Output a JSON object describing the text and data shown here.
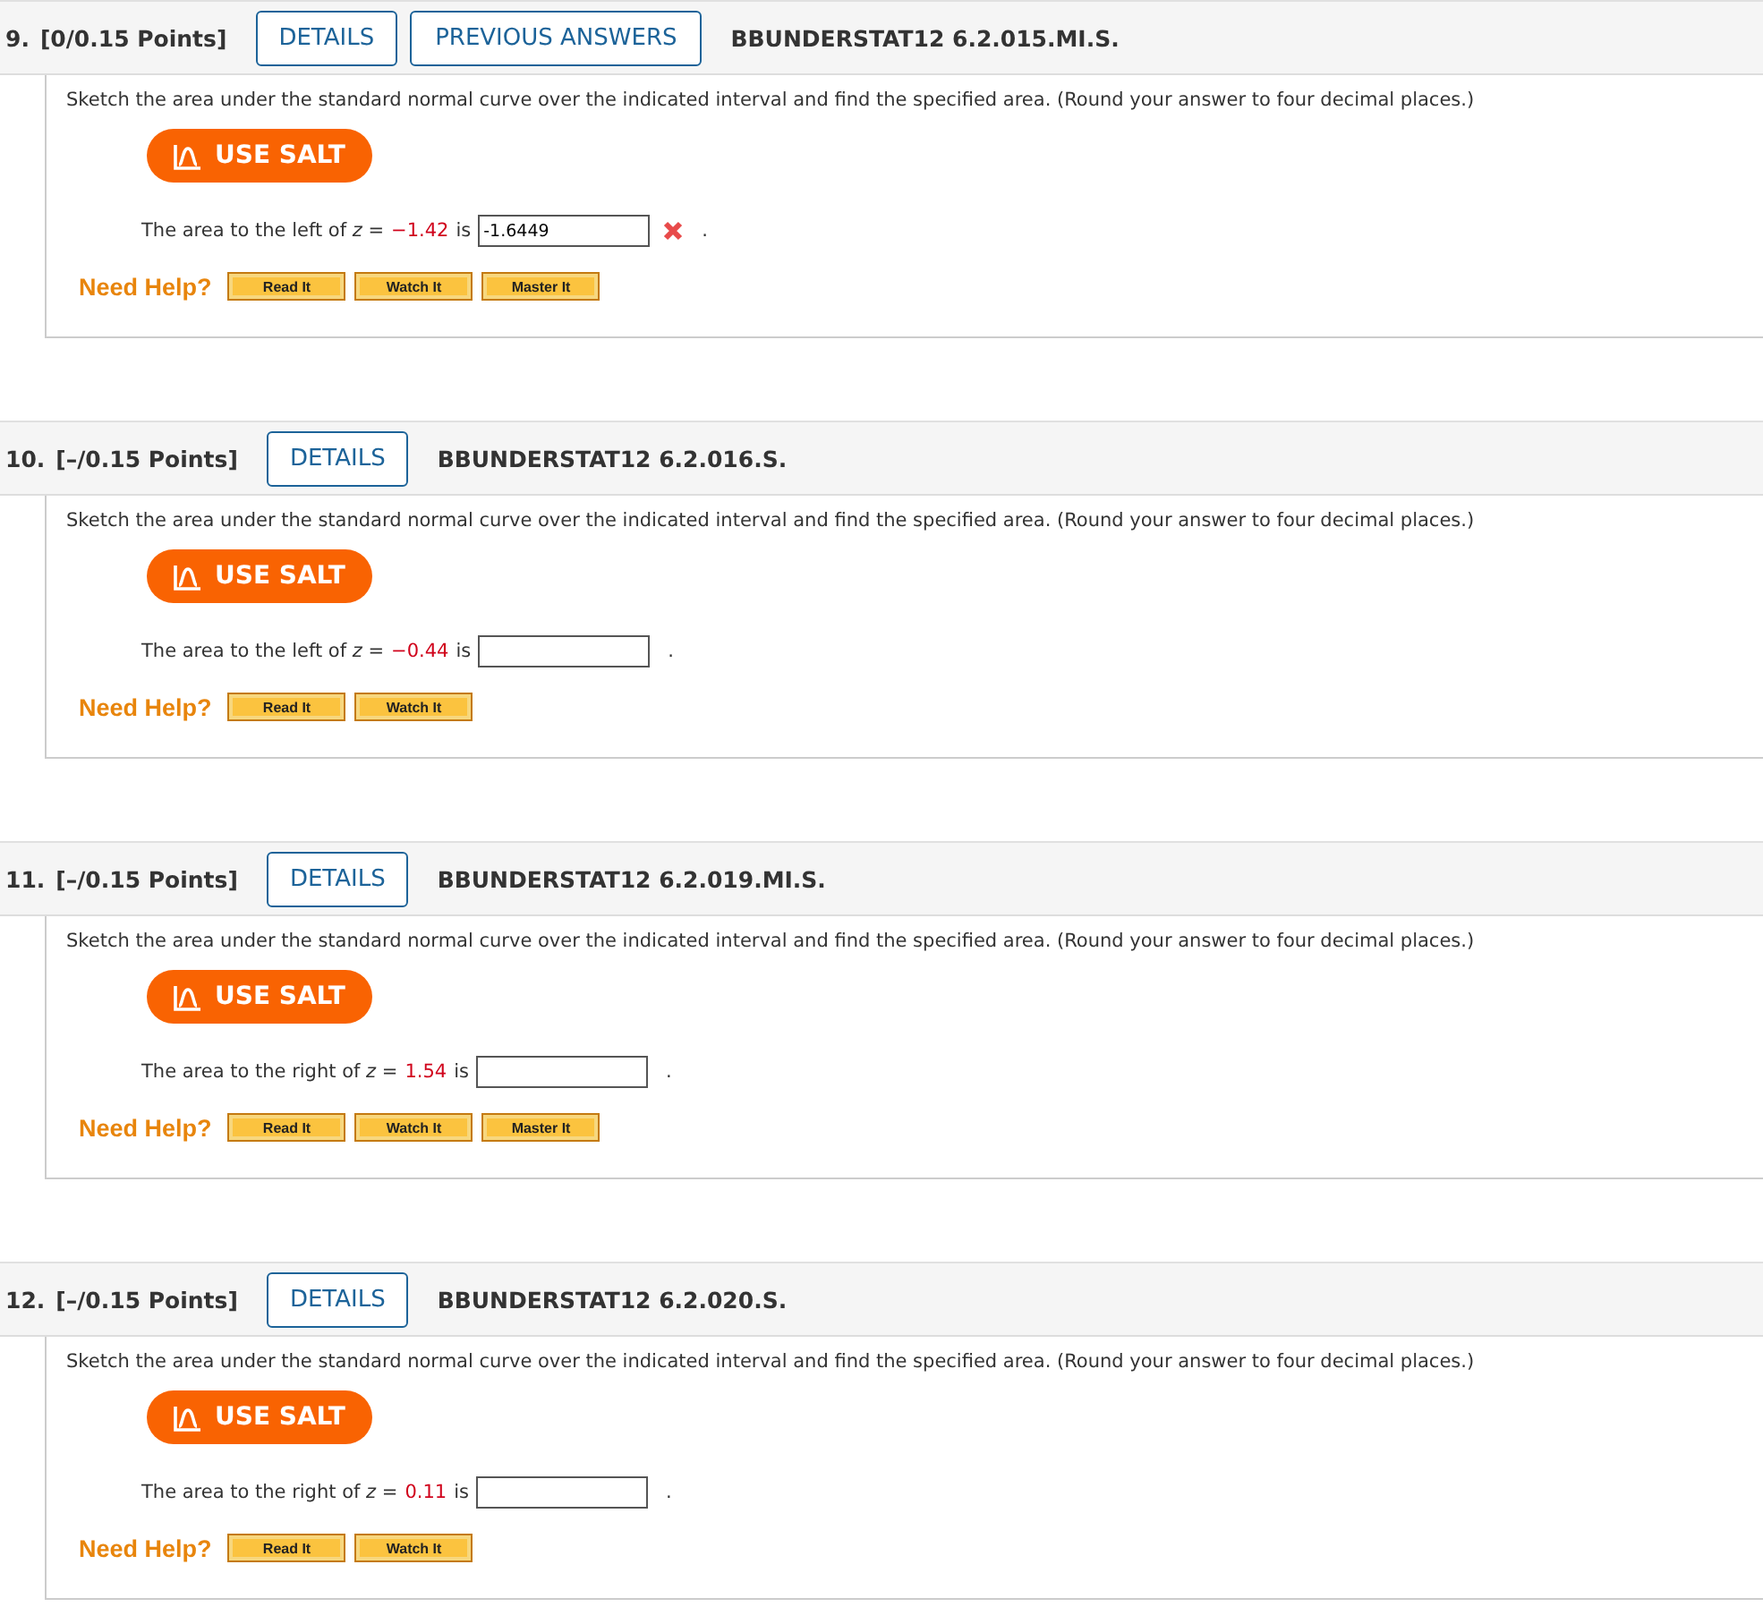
{
  "questions": [
    {
      "number": "9.",
      "points": "[0/0.15 Points]",
      "buttons": [
        {
          "kind": "details",
          "label": "DETAILS"
        },
        {
          "kind": "previous",
          "label": "PREVIOUS ANSWERS"
        }
      ],
      "code": "BBUNDERSTAT12 6.2.015.MI.S.",
      "instruction": "Sketch the area under the standard normal curve over the indicated interval and find the specified area. (Round your answer to four decimal places.)",
      "salt_label": "USE SALT",
      "prompt": "The area to the left of *z* =",
      "z_value": "−1.42",
      "prompt_end": "is",
      "answer": "-1.6449",
      "incorrect": true,
      "period": ".",
      "help_label": "Need Help?",
      "help_buttons": [
        "Read It",
        "Watch It",
        "Master It"
      ]
    },
    {
      "number": "10.",
      "points": "[–/0.15 Points]",
      "buttons": [
        {
          "kind": "details",
          "label": "DETAILS"
        }
      ],
      "code": "BBUNDERSTAT12 6.2.016.S.",
      "instruction": "Sketch the area under the standard normal curve over the indicated interval and find the specified area. (Round your answer to four decimal places.)",
      "salt_label": "USE SALT",
      "prompt": "The area to the left of *z* =",
      "z_value": "−0.44",
      "prompt_end": "is",
      "incorrect": false,
      "period": ".",
      "help_label": "Need Help?",
      "help_buttons": [
        "Read It",
        "Watch It"
      ]
    },
    {
      "number": "11.",
      "points": "[–/0.15 Points]",
      "buttons": [
        {
          "kind": "details",
          "label": "DETAILS"
        }
      ],
      "code": "BBUNDERSTAT12 6.2.019.MI.S.",
      "instruction": "Sketch the area under the standard normal curve over the indicated interval and find the specified area. (Round your answer to four decimal places.)",
      "salt_label": "USE SALT",
      "prompt": "The area to the right of *z* =",
      "z_value": "1.54",
      "prompt_end": "is",
      "incorrect": false,
      "period": ".",
      "help_label": "Need Help?",
      "help_buttons": [
        "Read It",
        "Watch It",
        "Master It"
      ]
    },
    {
      "number": "12.",
      "points": "[–/0.15 Points]",
      "buttons": [
        {
          "kind": "details",
          "label": "DETAILS"
        }
      ],
      "code": "BBUNDERSTAT12 6.2.020.S.",
      "instruction": "Sketch the area under the standard normal curve over the indicated interval and find the specified area. (Round your answer to four decimal places.)",
      "salt_label": "USE SALT",
      "prompt": "The area to the right of *z* =",
      "z_value": "0.11",
      "prompt_end": "is",
      "incorrect": false,
      "period": ".",
      "help_label": "Need Help?",
      "help_buttons": [
        "Read It",
        "Watch It"
      ]
    }
  ]
}
